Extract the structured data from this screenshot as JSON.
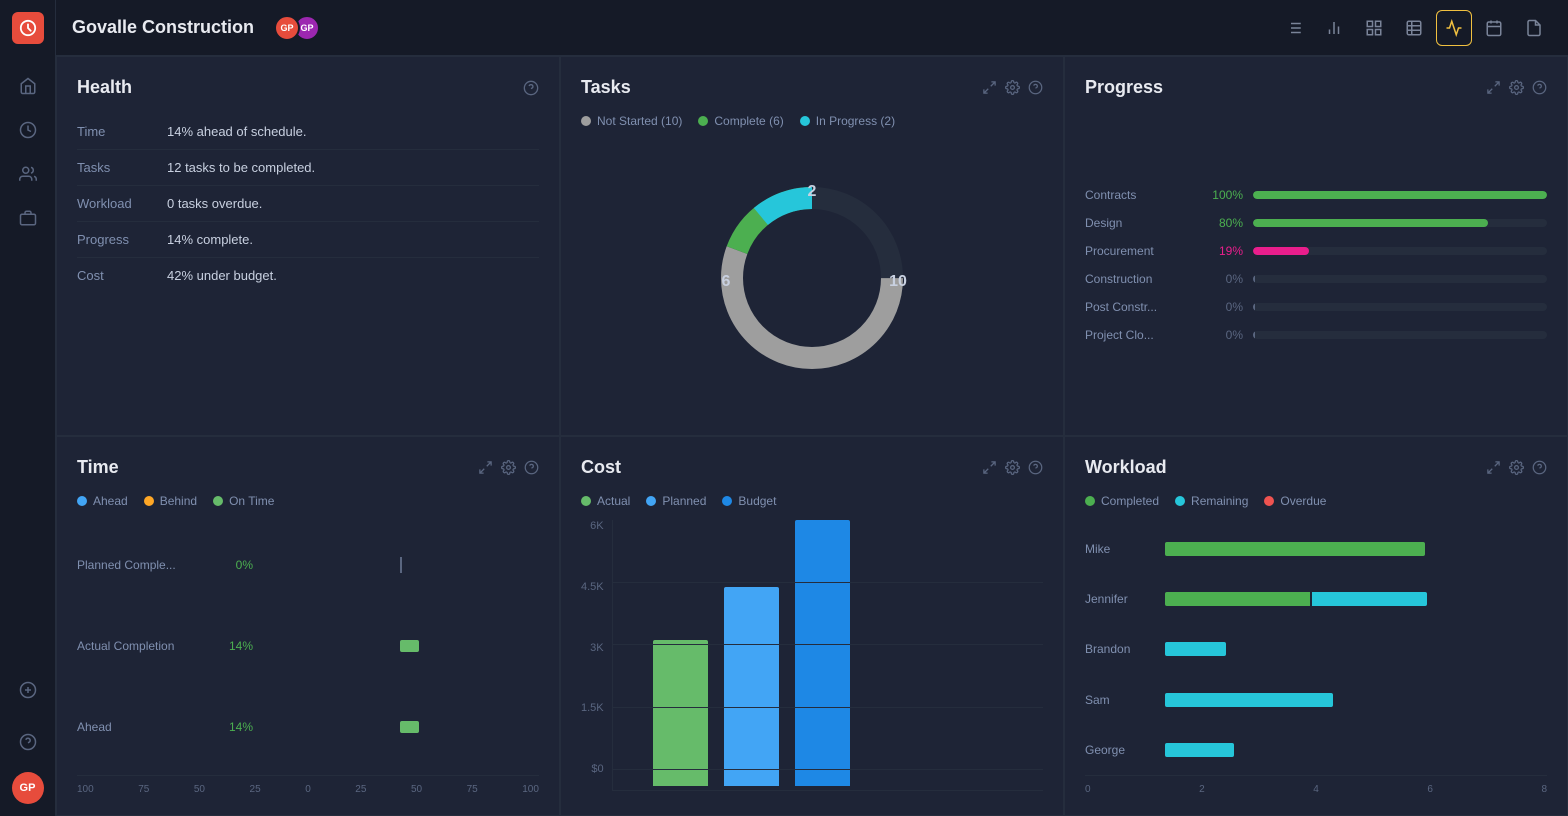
{
  "app": {
    "logo": "PM",
    "title": "Govalle Construction"
  },
  "header": {
    "title": "Govalle Construction",
    "avatars": [
      {
        "initials": "GP",
        "color": "#e74c3c"
      },
      {
        "initials": "GP",
        "color": "#9c27b0"
      }
    ],
    "tools": [
      {
        "name": "list-icon",
        "label": "List",
        "active": false
      },
      {
        "name": "bar-chart-icon",
        "label": "Bar Chart",
        "active": false
      },
      {
        "name": "grid-icon",
        "label": "Grid",
        "active": false
      },
      {
        "name": "table-icon",
        "label": "Table",
        "active": false
      },
      {
        "name": "pulse-icon",
        "label": "Pulse",
        "active": true
      },
      {
        "name": "calendar-icon",
        "label": "Calendar",
        "active": false
      },
      {
        "name": "document-icon",
        "label": "Document",
        "active": false
      }
    ]
  },
  "panels": {
    "health": {
      "title": "Health",
      "rows": [
        {
          "label": "Time",
          "value": "14% ahead of schedule."
        },
        {
          "label": "Tasks",
          "value": "12 tasks to be completed."
        },
        {
          "label": "Workload",
          "value": "0 tasks overdue."
        },
        {
          "label": "Progress",
          "value": "14% complete."
        },
        {
          "label": "Cost",
          "value": "42% under budget."
        }
      ]
    },
    "tasks": {
      "title": "Tasks",
      "legend": [
        {
          "label": "Not Started (10)",
          "color": "#9e9e9e"
        },
        {
          "label": "Complete (6)",
          "color": "#4caf50"
        },
        {
          "label": "In Progress (2)",
          "color": "#26c6da"
        }
      ],
      "donut": {
        "not_started": 10,
        "complete": 6,
        "in_progress": 2,
        "total": 18,
        "label_left": "6",
        "label_top": "2",
        "label_right": "10"
      }
    },
    "progress": {
      "title": "Progress",
      "rows": [
        {
          "label": "Contracts",
          "pct": 100,
          "pct_label": "100%",
          "color": "green",
          "fill_color": "#4caf50"
        },
        {
          "label": "Design",
          "pct": 80,
          "pct_label": "80%",
          "color": "green",
          "fill_color": "#4caf50"
        },
        {
          "label": "Procurement",
          "pct": 19,
          "pct_label": "19%",
          "color": "pink",
          "fill_color": "#e91e8c"
        },
        {
          "label": "Construction",
          "pct": 0,
          "pct_label": "0%",
          "color": "none",
          "fill_color": "none"
        },
        {
          "label": "Post Constr...",
          "pct": 0,
          "pct_label": "0%",
          "color": "none",
          "fill_color": "none"
        },
        {
          "label": "Project Clo...",
          "pct": 0,
          "pct_label": "0%",
          "color": "none",
          "fill_color": "none"
        }
      ]
    },
    "time": {
      "title": "Time",
      "legend": [
        {
          "label": "Ahead",
          "color": "#42a5f5"
        },
        {
          "label": "Behind",
          "color": "#ffa726"
        },
        {
          "label": "On Time",
          "color": "#66bb6a"
        }
      ],
      "rows": [
        {
          "label": "Planned Comple...",
          "pct_label": "0%",
          "pct": 0,
          "bar_color": "#5a6680",
          "bar_right": false
        },
        {
          "label": "Actual Completion",
          "pct_label": "14%",
          "pct": 14,
          "bar_color": "#66bb6a",
          "bar_right": true
        },
        {
          "label": "Ahead",
          "pct_label": "14%",
          "pct": 14,
          "bar_color": "#66bb6a",
          "bar_right": true
        }
      ],
      "axis": [
        "100",
        "75",
        "50",
        "25",
        "0",
        "25",
        "50",
        "75",
        "100"
      ]
    },
    "cost": {
      "title": "Cost",
      "legend": [
        {
          "label": "Actual",
          "color": "#66bb6a"
        },
        {
          "label": "Planned",
          "color": "#42a5f5"
        },
        {
          "label": "Budget",
          "color": "#1e88e5"
        }
      ],
      "y_labels": [
        "6K",
        "4.5K",
        "3K",
        "1.5K",
        "$0"
      ],
      "bars": [
        {
          "actual": 55,
          "planned": 0,
          "budget": 0
        },
        {
          "actual": 0,
          "planned": 75,
          "budget": 0
        },
        {
          "actual": 0,
          "planned": 0,
          "budget": 100
        }
      ]
    },
    "workload": {
      "title": "Workload",
      "legend": [
        {
          "label": "Completed",
          "color": "#4caf50"
        },
        {
          "label": "Remaining",
          "color": "#26c6da"
        },
        {
          "label": "Overdue",
          "color": "#ef5350"
        }
      ],
      "rows": [
        {
          "label": "Mike",
          "completed": 100,
          "remaining": 0,
          "overdue": 0
        },
        {
          "label": "Jennifer",
          "completed": 55,
          "remaining": 45,
          "overdue": 0
        },
        {
          "label": "Brandon",
          "completed": 0,
          "remaining": 28,
          "overdue": 0
        },
        {
          "label": "Sam",
          "completed": 0,
          "remaining": 72,
          "overdue": 0
        },
        {
          "label": "George",
          "completed": 0,
          "remaining": 32,
          "overdue": 0
        }
      ],
      "axis": [
        "0",
        "2",
        "4",
        "6",
        "8"
      ]
    }
  }
}
